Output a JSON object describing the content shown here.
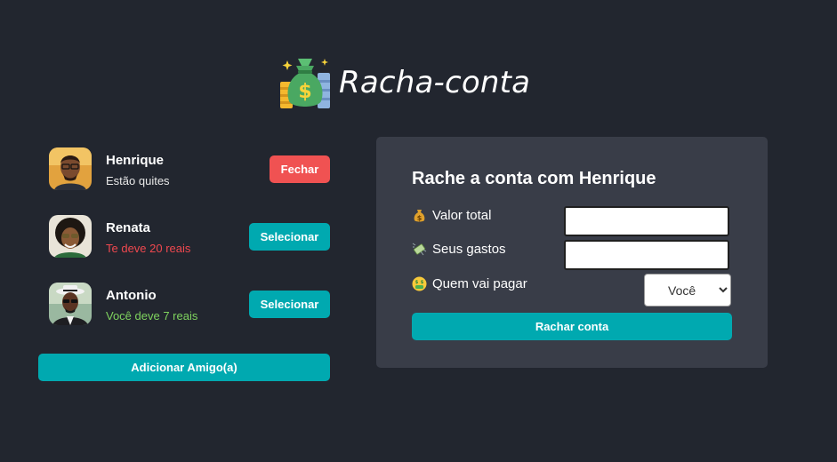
{
  "header": {
    "title": "Racha-conta",
    "logo_icon": "money-bag-icon"
  },
  "friends": [
    {
      "name": "Henrique",
      "status": "Estão quites",
      "status_color": "#e8e8e8",
      "button_label": "Fechar"
    },
    {
      "name": "Renata",
      "status": "Te deve 20 reais",
      "status_color": "#f0484f",
      "button_label": "Selecionar"
    },
    {
      "name": "Antonio",
      "status": "Você deve 7 reais",
      "status_color": "#7fd35e",
      "button_label": "Selecionar"
    }
  ],
  "add_friend_label": "Adicionar Amigo(a)",
  "split_form": {
    "title": "Rache a conta com Henrique",
    "total_label": "Valor total",
    "total_icon": "money-bag-icon",
    "total_value": "",
    "expenses_label": "Seus gastos",
    "expenses_icon": "flying-money-icon",
    "expenses_value": "",
    "payer_label": "Quem vai pagar",
    "payer_icon": "money-mouth-face-icon",
    "payer_selected": "Você",
    "submit_label": "Rachar conta"
  },
  "colors": {
    "background": "#22262f",
    "panel": "#393d48",
    "accent_teal": "#00a9b0",
    "accent_red": "#f05252"
  }
}
